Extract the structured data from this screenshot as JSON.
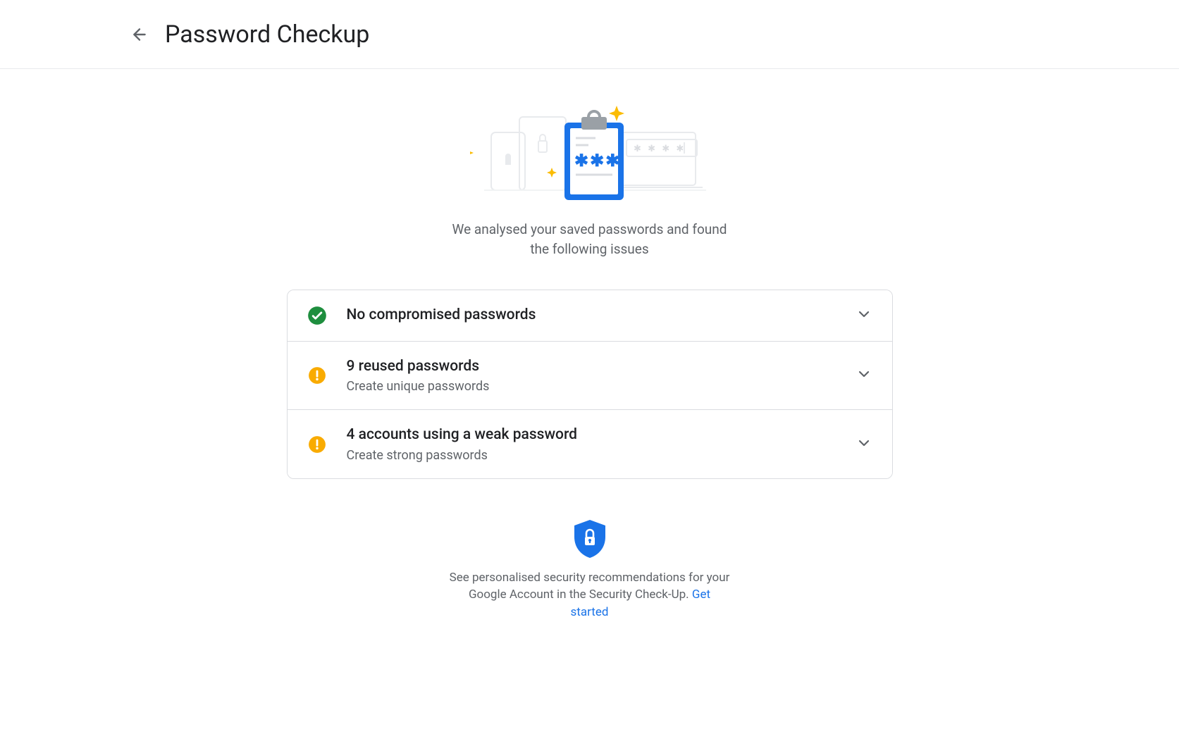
{
  "header": {
    "title": "Password Checkup"
  },
  "hero": {
    "text": "We analysed your saved passwords and found the following issues"
  },
  "rows": [
    {
      "icon": "check-circle",
      "title": "No compromised passwords",
      "sub": ""
    },
    {
      "icon": "warning-circle",
      "title": "9 reused passwords",
      "sub": "Create unique passwords"
    },
    {
      "icon": "warning-circle",
      "title": "4 accounts using a weak password",
      "sub": "Create strong passwords"
    }
  ],
  "footer": {
    "text": "See personalised security recommendations for your Google Account in the Security Check-Up. ",
    "link": "Get started"
  },
  "colors": {
    "green": "#1e8e3e",
    "yellow": "#f9ab00",
    "blue": "#1a73e8"
  }
}
